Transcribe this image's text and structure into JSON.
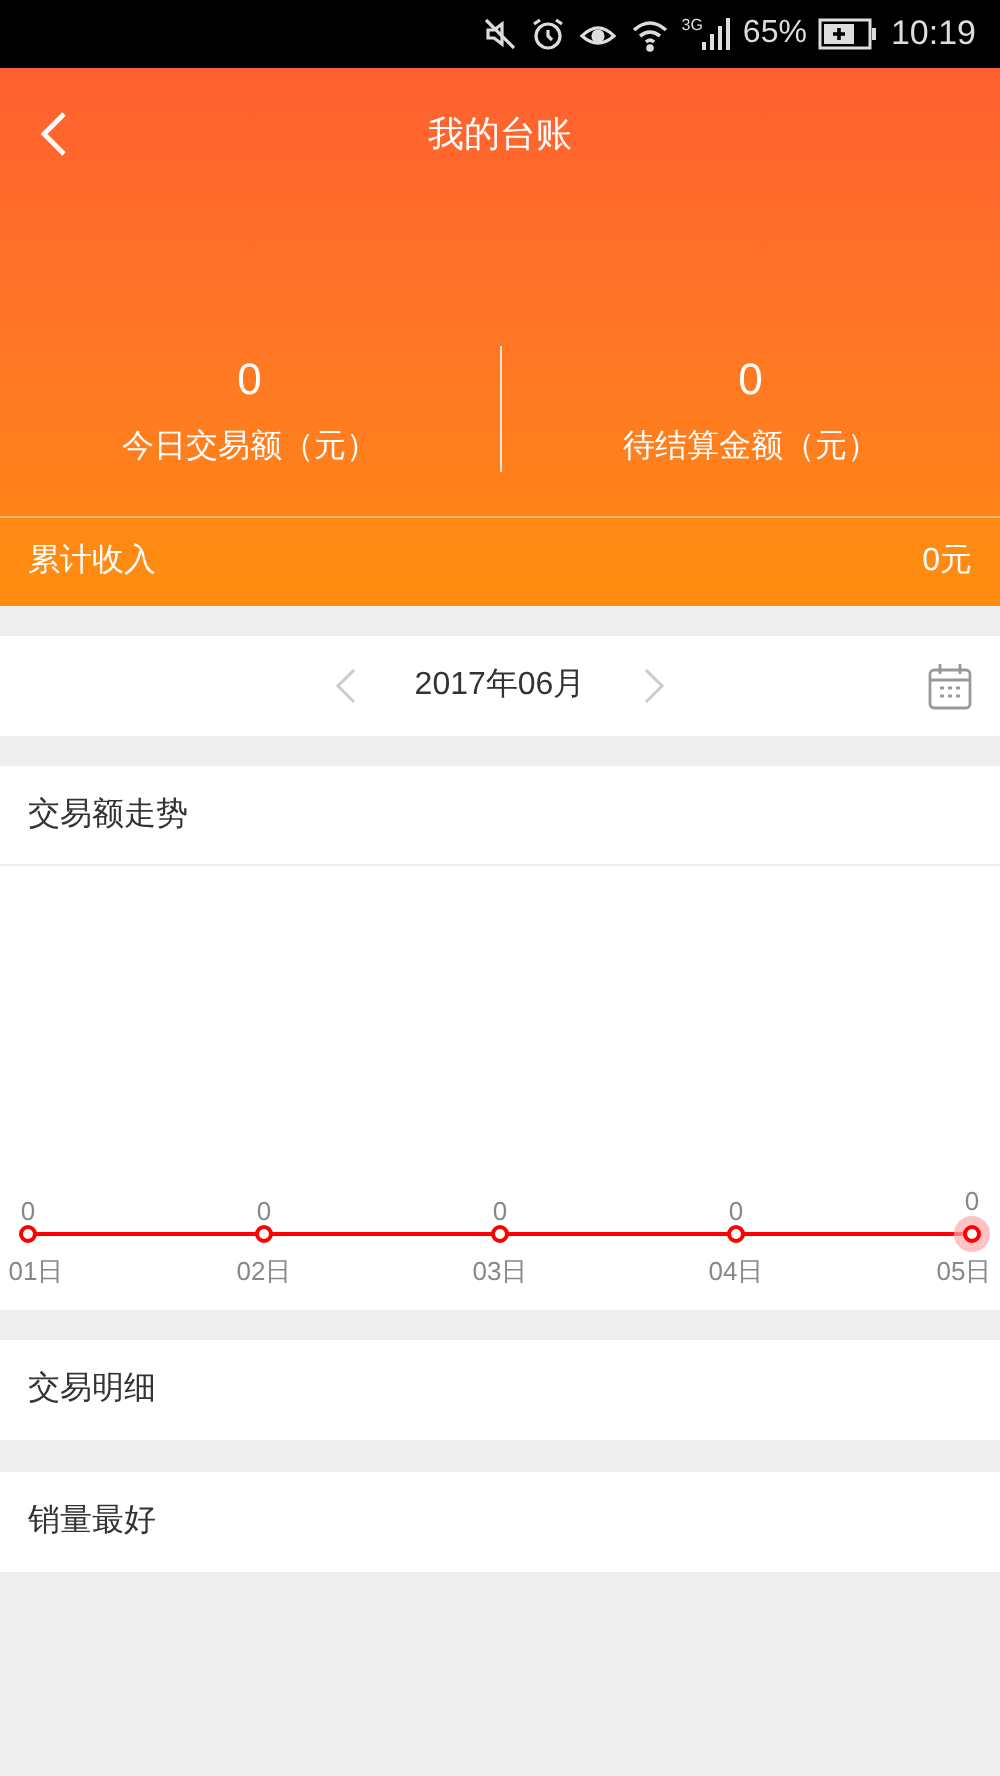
{
  "status_bar": {
    "network": "3G",
    "battery": "65%",
    "time": "10:19"
  },
  "header": {
    "title": "我的台账"
  },
  "summary": [
    {
      "value": "0",
      "label": "今日交易额（元）"
    },
    {
      "value": "0",
      "label": "待结算金额（元）"
    }
  ],
  "total": {
    "label": "累计收入",
    "value": "0元"
  },
  "month": {
    "label": "2017年06月"
  },
  "trend": {
    "title": "交易额走势",
    "points": [
      {
        "day": "01日",
        "value": "0",
        "selected": false
      },
      {
        "day": "02日",
        "value": "0",
        "selected": false
      },
      {
        "day": "03日",
        "value": "0",
        "selected": false
      },
      {
        "day": "04日",
        "value": "0",
        "selected": false
      },
      {
        "day": "05日",
        "value": "0",
        "selected": true
      }
    ]
  },
  "sections": [
    {
      "title": "交易明细"
    },
    {
      "title": "销量最好"
    }
  ]
}
